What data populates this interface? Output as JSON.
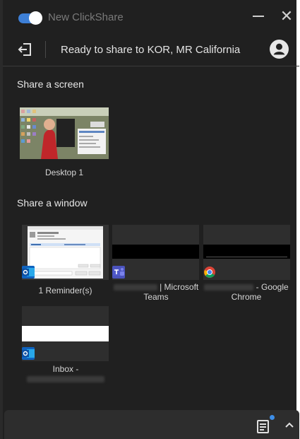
{
  "titlebar": {
    "app_title": "New ClickShare",
    "minimize_icon": "minimize-icon",
    "close_icon": "close-icon",
    "close_glyph": "✕"
  },
  "status": {
    "text": "Ready to share to KOR, MR California",
    "exit_icon": "exit-icon",
    "avatar_icon": "account-icon"
  },
  "share_screen": {
    "title": "Share a screen",
    "screens": [
      {
        "label": "Desktop 1"
      }
    ]
  },
  "share_window": {
    "title": "Share a window",
    "windows": [
      {
        "label": "1 Reminder(s)",
        "app_icon": "outlook-icon"
      },
      {
        "label_suffix": "| Microsoft",
        "label_line2": "Teams",
        "app_icon": "teams-icon"
      },
      {
        "label_suffix": "- Google",
        "label_line2": "Chrome",
        "app_icon": "chrome-icon"
      },
      {
        "label": "Inbox -",
        "app_icon": "outlook-icon"
      }
    ]
  },
  "bottombar": {
    "notes_icon": "notes-icon",
    "expand_icon": "chevron-up-icon"
  },
  "colors": {
    "background": "#202020",
    "accent": "#3d7fd6",
    "bottom_bar": "#2d2d2d"
  }
}
